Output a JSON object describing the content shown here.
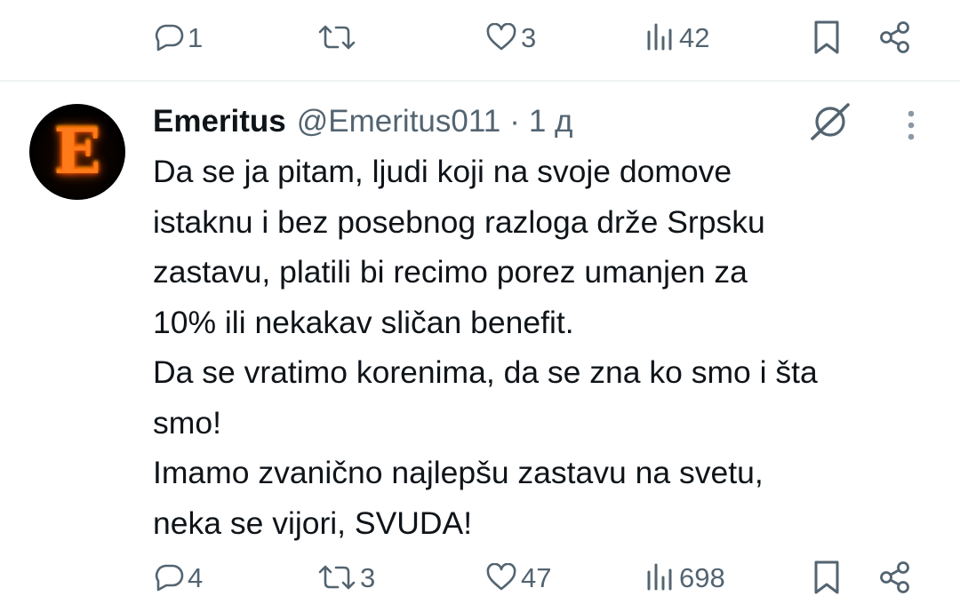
{
  "prev_actions": {
    "reply_count": "1",
    "retweet_count": "",
    "like_count": "3",
    "view_count": "42"
  },
  "post": {
    "author_name": "Emeritus",
    "handle": "@Emeritus011",
    "separator": "·",
    "time": "1 д",
    "avatar_letter": "E",
    "lines": [
      "Da se ja pitam, ljudi koji na svoje domove",
      "istaknu i bez posebnog razloga drže Srpsku",
      "zastavu, platili bi recimo porez umanjen za",
      "10% ili nekakav sličan benefit.",
      "Da se vratimo korenima, da se zna ko smo i šta",
      "smo!",
      "Imamo zvanično najlepšu zastavu na svetu,",
      "neka se vijori, SVUDA!"
    ],
    "actions": {
      "reply_count": "4",
      "retweet_count": "3",
      "like_count": "47",
      "view_count": "698"
    }
  },
  "colors": {
    "icon_gray": "#536471",
    "text": "#0f1419",
    "divider": "#eff3f4"
  }
}
